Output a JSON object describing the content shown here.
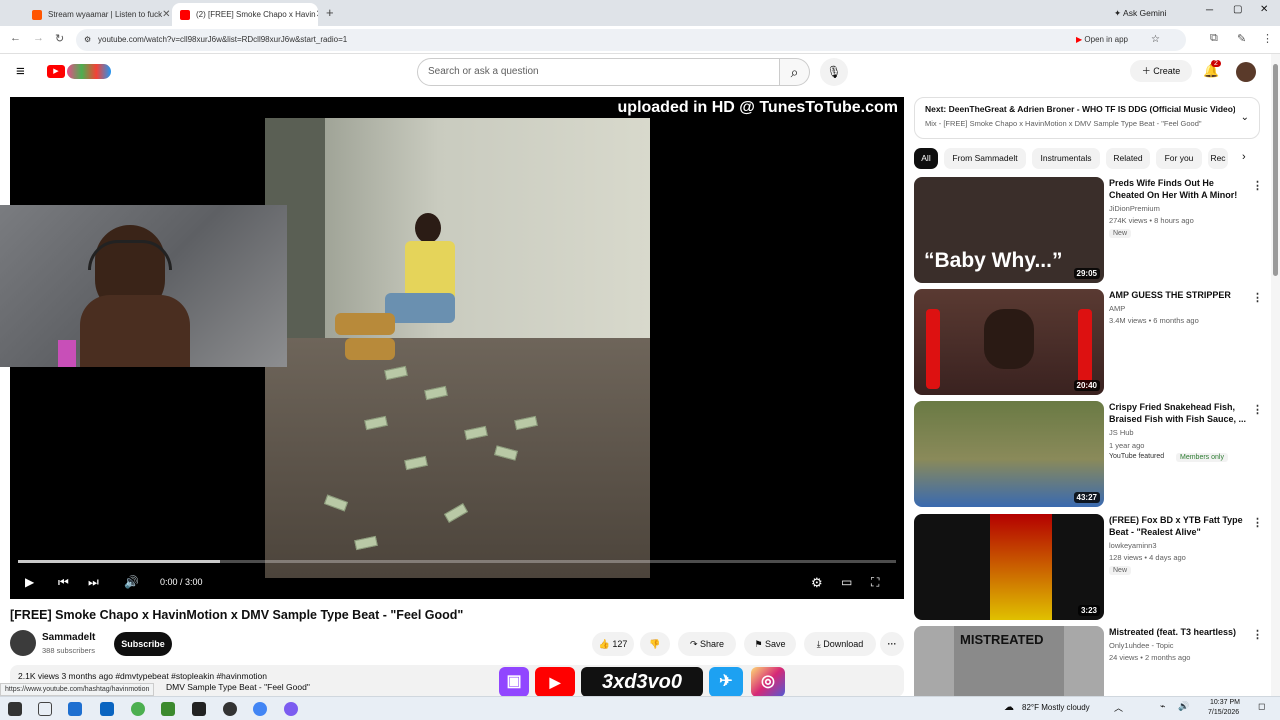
{
  "browser": {
    "tabs": [
      {
        "title": "Stream wyaamar | Listen to fuck",
        "color": "#ff5500",
        "active": false
      },
      {
        "title": "(2) [FREE] Smoke Chapo x Havin",
        "color": "#ff0000",
        "active": true
      }
    ],
    "new_tab": "+",
    "ask_gemini": "Ask Gemini",
    "url": "youtube.com/watch?v=cll98xurJ6w&list=RDcll98xurJ6w&start_radio=1",
    "open_in_app": "Open in app"
  },
  "yt": {
    "search_placeholder": "Search or ask a question",
    "create_label": "Create",
    "notif_count": "2"
  },
  "player": {
    "watermark": "uploaded in HD @ TunesToTube.com",
    "time": "0:00 / 3:00",
    "progress_fraction": 0.23
  },
  "video": {
    "title": "[FREE] Smoke Chapo x HavinMotion x DMV Sample Type Beat - \"Feel Good\"",
    "channel": "Sammadelt",
    "subscribers": "388 subscribers",
    "subscribe": "Subscribe",
    "likes": "127",
    "share": "Share",
    "save": "Save",
    "download": "Download",
    "desc_line1": "2.1K views  3 months ago  #dmvtypebeat #stopleakin #havinmotion",
    "desc_line2": "DMV Sample Type Beat - \"Feel Good\"",
    "status_url": "https://www.youtube.com/hashtag/havinmotion"
  },
  "overlay": {
    "handle": "3xd3vo0"
  },
  "next": {
    "line1": "Next: DeenTheGreat & Adrien Broner - WHO TF IS DDG (Official Music Video)...",
    "line2": "Mix - [FREE] Smoke Chapo x HavinMotion x DMV Sample Type Beat - \"Feel Good\""
  },
  "chips": [
    "All",
    "From Sammadelt",
    "Instrumentals",
    "Related",
    "For you",
    "Rec"
  ],
  "recommendations": [
    {
      "title": "Preds Wife Finds Out He Cheated On Her With A Minor!",
      "channel": "JiDionPremium",
      "meta": "274K views • 8 hours ago",
      "badge": "New",
      "duration": "29:05",
      "thumb_text": "“Baby Why...”",
      "bg": "#3a2e2a"
    },
    {
      "title": "AMP GUESS THE STRIPPER",
      "channel": "AMP",
      "meta": "3.4M views • 6 months ago",
      "badge": "",
      "duration": "20:40",
      "thumb_text": "",
      "bg": "#4a2a2a"
    },
    {
      "title": "Crispy Fried Snakehead Fish, Braised Fish with Fish Sauce, ...",
      "channel": "JS Hub",
      "meta": "1 year ago",
      "badge": "YouTube featured",
      "badge2": "Members only",
      "duration": "43:27",
      "thumb_text": "",
      "bg": "#5d6b3a"
    },
    {
      "title": "(FREE) Fox BD x YTB Fatt Type Beat - \"Realest Alive\"",
      "channel": "lowkeyaminn3",
      "meta": "128 views • 4 days ago",
      "badge": "New",
      "duration": "3:23",
      "thumb_text": "",
      "bg": "#1a1a1a"
    },
    {
      "title": "Mistreated (feat. T3 heartless)",
      "channel": "Only1uhdee - Topic",
      "meta": "24 views • 2 months ago",
      "badge": "",
      "duration": "",
      "thumb_text": "MISTREATED",
      "bg": "#9a9a9a"
    }
  ],
  "taskbar": {
    "weather": "82°F  Mostly cloudy",
    "time": "10:37 PM",
    "date": "7/15/2026"
  }
}
